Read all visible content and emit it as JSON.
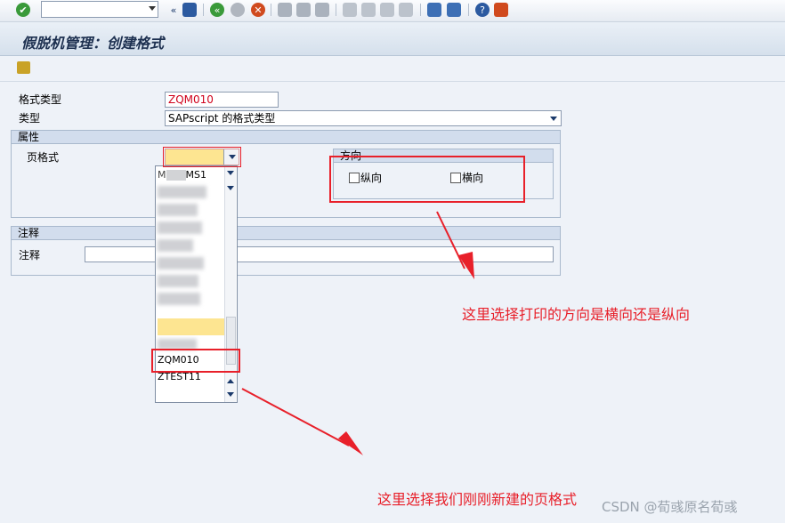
{
  "toolbar": {
    "command_field": {
      "value": ""
    },
    "icons": [
      "enter-check",
      "save",
      "back",
      "exit",
      "cancel",
      "print",
      "find",
      "find-next",
      "first-page",
      "prev-page",
      "next-page",
      "last-page",
      "create-session",
      "shortcut",
      "help",
      "layout"
    ]
  },
  "screen": {
    "title": "假脱机管理：创建格式"
  },
  "form": {
    "format_type_label": "格式类型",
    "format_type_value": "ZQM010",
    "type_label": "类型",
    "type_value": "SAPscript 的格式类型"
  },
  "attributes": {
    "header": "属性",
    "page_format_label": "页格式",
    "page_format_value": "",
    "orientation": {
      "header": "方向",
      "portrait_label": "纵向",
      "portrait_checked": false,
      "landscape_label": "横向",
      "landscape_checked": false
    }
  },
  "comment": {
    "header": "注释",
    "label": "注释",
    "value": ""
  },
  "page_format_list": {
    "items": [
      "MS1",
      "ZQM010",
      "ZTEST11"
    ]
  },
  "annotations": {
    "orientation_note": "这里选择打印的方向是横向还是纵向",
    "pageformat_note": "这里选择我们刚刚新建的页格式"
  },
  "watermark": "CSDN @荀彧原名荀彧",
  "colors": {
    "annotation": "#e8202a",
    "field_highlight": "#fde591"
  }
}
